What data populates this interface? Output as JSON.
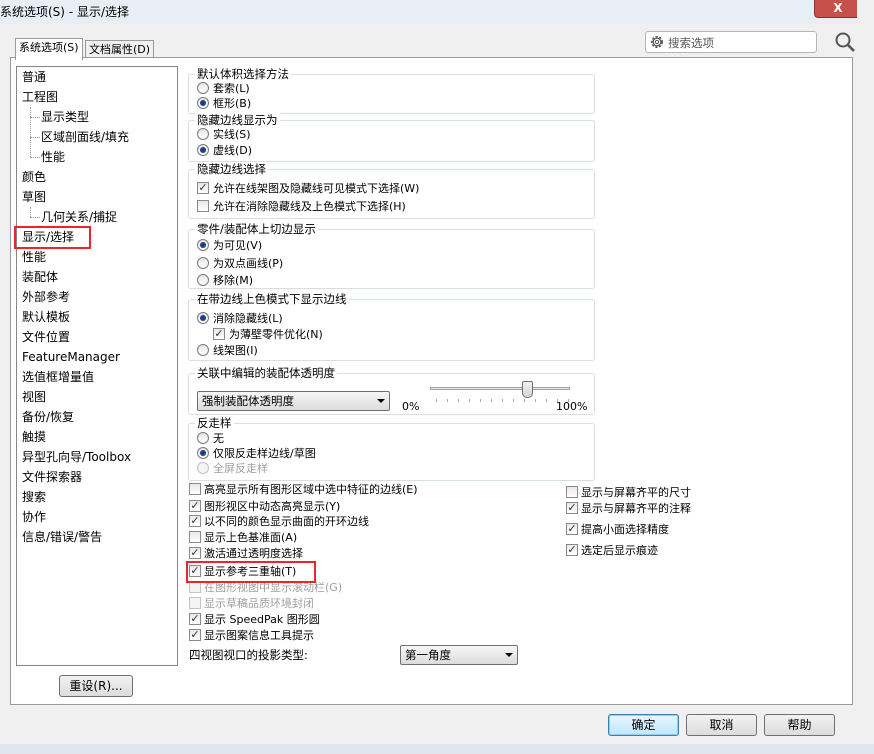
{
  "window": {
    "title": "系统选项(S) - 显示/选择",
    "close_label": "X"
  },
  "tabs": [
    "系统选项(S)",
    "文档属性(D)"
  ],
  "search": {
    "placeholder": "搜索选项"
  },
  "tree": {
    "items": [
      "普通",
      "工程图",
      "显示类型",
      "区域剖面线/填充",
      "性能",
      "颜色",
      "草图",
      "几何关系/捕捉",
      "显示/选择",
      "性能",
      "装配体",
      "外部参考",
      "默认模板",
      "文件位置",
      "FeatureManager",
      "选值框增量值",
      "视图",
      "备份/恢复",
      "触摸",
      "异型孔向导/Toolbox",
      "文件探索器",
      "搜索",
      "协作",
      "信息/错误/警告"
    ],
    "selected": "显示/选择"
  },
  "groups": {
    "volume_select": {
      "title": "默认体积选择方法",
      "options": [
        "套索(L)",
        "框形(B)"
      ],
      "selected": "框形(B)"
    },
    "hidden_edge_display": {
      "title": "隐藏边线显示为",
      "options": [
        "实线(S)",
        "虚线(D)"
      ],
      "selected": "虚线(D)"
    },
    "hidden_edge_select": {
      "title": "隐藏边线选择",
      "options": [
        {
          "label": "允许在线架图及隐藏线可见模式下选择(W)",
          "checked": true
        },
        {
          "label": "允许在消除隐藏线及上色模式下选择(H)",
          "checked": false
        }
      ]
    },
    "tangent_edge": {
      "title": "零件/装配体上切边显示",
      "options": [
        "为可见(V)",
        "为双点画线(P)",
        "移除(M)"
      ],
      "selected": "为可见(V)"
    },
    "shaded_edges": {
      "title": "在带边线上色模式下显示边线",
      "options": [
        "消除隐藏线(L)",
        "线架图(I)"
      ],
      "selected": "消除隐藏线(L)",
      "sub_option": {
        "label": "为薄壁零件优化(N)",
        "checked": true
      }
    },
    "transparency": {
      "title": "关联中编辑的装配体透明度",
      "combo_value": "强制装配体透明度",
      "min_label": "0%",
      "max_label": "100%",
      "slider_value": 0.75
    },
    "antialias": {
      "title": "反走样",
      "options": [
        "无",
        "仅限反走样边线/草图",
        "全屏反走样"
      ],
      "selected": "仅限反走样边线/草图",
      "disabled": [
        "全屏反走样"
      ]
    }
  },
  "left_checks": [
    {
      "label": "高亮显示所有图形区域中选中特征的边线(E)",
      "checked": false,
      "disabled": false
    },
    {
      "label": "图形视区中动态高亮显示(Y)",
      "checked": true,
      "disabled": false
    },
    {
      "label": "以不同的颜色显示曲面的开环边线",
      "checked": true,
      "disabled": false
    },
    {
      "label": "显示上色基准面(A)",
      "checked": false,
      "disabled": false
    },
    {
      "label": "激活通过透明度选择",
      "checked": true,
      "disabled": false
    },
    {
      "label": "显示参考三重轴(T)",
      "checked": true,
      "disabled": false
    },
    {
      "label": "在图形视图中显示滚动栏(G)",
      "checked": false,
      "disabled": true
    },
    {
      "label": "显示草稿品质环境封闭",
      "checked": false,
      "disabled": true
    },
    {
      "label": "显示 SpeedPak 图形圆",
      "checked": true,
      "disabled": false
    },
    {
      "label": "显示图案信息工具提示",
      "checked": true,
      "disabled": false
    }
  ],
  "right_checks": [
    {
      "label": "显示与屏幕齐平的尺寸",
      "checked": false
    },
    {
      "label": "显示与屏幕齐平的注释",
      "checked": true
    },
    {
      "label": "提高小面选择精度",
      "checked": true
    },
    {
      "label": "选定后显示痕迹",
      "checked": true
    }
  ],
  "projection": {
    "label": "四视图视口的投影类型:",
    "value": "第一角度"
  },
  "buttons": {
    "reset": "重设(R)...",
    "ok": "确定",
    "cancel": "取消",
    "help": "帮助"
  }
}
